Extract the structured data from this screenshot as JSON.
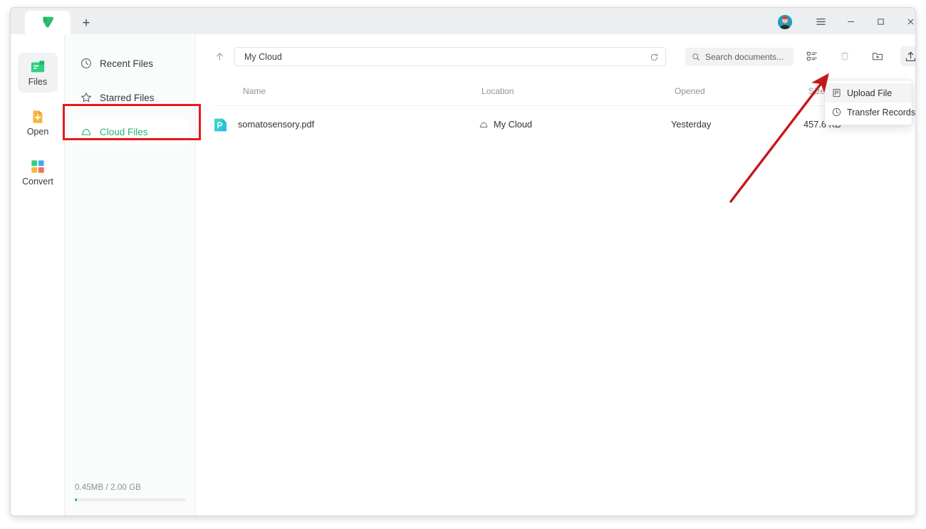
{
  "titlebar": {
    "new_tab_label": "+",
    "logo_name": "app-logo",
    "avatar_name": "user-avatar",
    "menu_label": "☰",
    "minimize_label": "—",
    "maximize_label": "□",
    "close_label": "✕"
  },
  "rail": {
    "items": [
      {
        "label": "Files",
        "icon": "files-icon",
        "selected": true
      },
      {
        "label": "Open",
        "icon": "open-icon",
        "selected": false
      },
      {
        "label": "Convert",
        "icon": "convert-icon",
        "selected": false
      }
    ]
  },
  "nav": {
    "items": [
      {
        "label": "Recent Files",
        "icon": "clock-icon",
        "selected": false
      },
      {
        "label": "Starred Files",
        "icon": "star-icon",
        "selected": false
      },
      {
        "label": "Cloud Files",
        "icon": "cloud-icon",
        "selected": true
      }
    ],
    "storage": {
      "text": "0.45MB  / 2.00 GB",
      "used": "0.45MB",
      "total": "2.00 GB",
      "percent": 0.02
    }
  },
  "toolbar": {
    "up_label": "↑",
    "path": "My Cloud",
    "refresh_label": "⟳",
    "search_placeholder": "Search documents...",
    "icons": [
      {
        "name": "list-view-icon",
        "active": false
      },
      {
        "name": "trash-icon",
        "active": false,
        "disabled": true
      },
      {
        "name": "new-folder-icon",
        "active": false
      },
      {
        "name": "upload-icon",
        "active": true
      }
    ]
  },
  "dropdown": {
    "open": true,
    "items": [
      {
        "label": "Upload File",
        "icon": "upload-file-icon",
        "highlighted": true
      },
      {
        "label": "Transfer Records",
        "icon": "transfer-records-icon",
        "highlighted": false
      }
    ]
  },
  "table": {
    "columns": [
      "Name",
      "Location",
      "Opened",
      "Size"
    ],
    "rows": [
      {
        "name": "somatosensory.pdf",
        "location": "My Cloud",
        "opened": "Yesterday",
        "size": "457.6 KB",
        "icon": "pdf-file-icon"
      }
    ]
  },
  "annotations": {
    "highlight_box": {
      "target": "Cloud Files",
      "color": "#e8191b"
    },
    "arrow": {
      "points_to": "Upload File",
      "color": "#c4191c"
    }
  },
  "colors": {
    "brand_green": "#2bb673",
    "annotation_red": "#e8191b",
    "titlebar_bg": "#edeeef",
    "nav_bg": "#fafbfb"
  }
}
